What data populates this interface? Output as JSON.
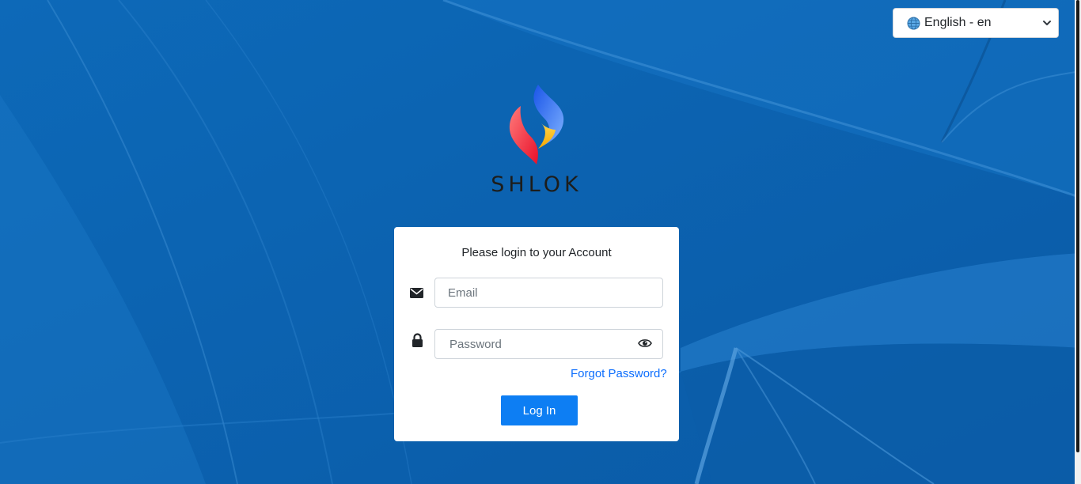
{
  "language_select": {
    "value": "English - en",
    "icon": "globe-icon"
  },
  "brand": {
    "name": "SHLOK",
    "logo_colors": {
      "blue": "#3b7cf0",
      "red": "#ff3b3b",
      "yellow": "#ffc21c"
    }
  },
  "login_card": {
    "heading": "Please login to your Account",
    "email": {
      "placeholder": "Email",
      "value": "",
      "icon": "envelope-icon"
    },
    "password": {
      "placeholder": "Password",
      "value": "",
      "icon": "lock-icon",
      "toggle_icon": "eye-icon"
    },
    "forgot_password": "Forgot Password?",
    "login_button": "Log In"
  },
  "colors": {
    "background": "#0a62b0",
    "primary": "#0d7ef3",
    "link": "#0d6efd"
  }
}
